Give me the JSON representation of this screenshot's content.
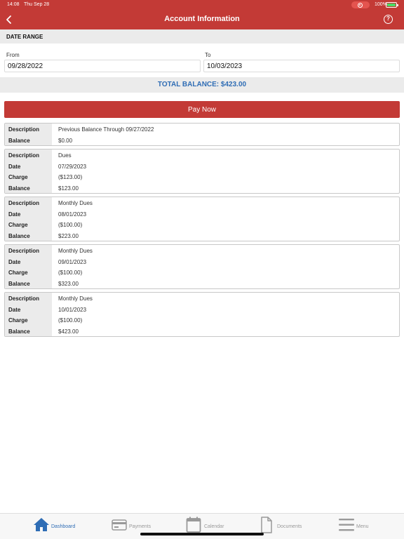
{
  "status_bar": {
    "time": "14:08",
    "date": "Thu Sep 28",
    "battery": "100%"
  },
  "header": {
    "title": "Account Information",
    "help_label": "?"
  },
  "date_range": {
    "label": "DATE RANGE",
    "from_label": "From",
    "from_value": "09/28/2022",
    "to_label": "To",
    "to_value": "10/03/2023"
  },
  "total_balance": "TOTAL BALANCE: $423.00",
  "pay_button": "Pay Now",
  "transactions": [
    {
      "rows": [
        {
          "label": "Description",
          "value": "Previous Balance Through 09/27/2022"
        },
        {
          "label": "Balance",
          "value": "$0.00"
        }
      ]
    },
    {
      "rows": [
        {
          "label": "Description",
          "value": "Dues"
        },
        {
          "label": "Date",
          "value": "07/29/2023"
        },
        {
          "label": "Charge",
          "value": "($123.00)"
        },
        {
          "label": "Balance",
          "value": "$123.00"
        }
      ]
    },
    {
      "rows": [
        {
          "label": "Description",
          "value": "Monthly Dues"
        },
        {
          "label": "Date",
          "value": "08/01/2023"
        },
        {
          "label": "Charge",
          "value": "($100.00)"
        },
        {
          "label": "Balance",
          "value": "$223.00"
        }
      ]
    },
    {
      "rows": [
        {
          "label": "Description",
          "value": "Monthly Dues"
        },
        {
          "label": "Date",
          "value": "09/01/2023"
        },
        {
          "label": "Charge",
          "value": "($100.00)"
        },
        {
          "label": "Balance",
          "value": "$323.00"
        }
      ]
    },
    {
      "rows": [
        {
          "label": "Description",
          "value": "Monthly Dues"
        },
        {
          "label": "Date",
          "value": "10/01/2023"
        },
        {
          "label": "Charge",
          "value": "($100.00)"
        },
        {
          "label": "Balance",
          "value": "$423.00"
        }
      ]
    }
  ],
  "tabs": [
    {
      "label": "Dashboard",
      "icon": "home-icon",
      "active": true
    },
    {
      "label": "Payments",
      "icon": "credit-card-icon",
      "active": false
    },
    {
      "label": "Calendar",
      "icon": "calendar-icon",
      "active": false
    },
    {
      "label": "Documents",
      "icon": "document-icon",
      "active": false
    },
    {
      "label": "Menu",
      "icon": "hamburger-menu-icon",
      "active": false
    }
  ],
  "colors": {
    "brand_red": "#c33a36",
    "accent_blue": "#2f6db5",
    "inactive_gray": "#999999",
    "panel_gray": "#ebebeb"
  }
}
